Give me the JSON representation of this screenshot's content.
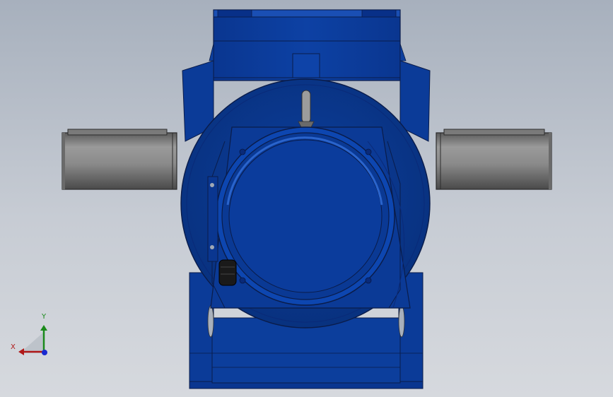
{
  "viewport": {
    "background_top": "#a7b0bd",
    "background_bottom": "#d6d9de"
  },
  "model": {
    "body_color": "#0c3f9e",
    "body_dark": "#072a6e",
    "body_light": "#1c56c2",
    "shaft_color": "#8c8c8c",
    "shaft_dark": "#5e5e5e"
  },
  "triad": {
    "x_label": "X",
    "y_label": "Y",
    "x_color": "#b01818",
    "y_color": "#1a8a1a",
    "z_color": "#1a2ad0"
  }
}
